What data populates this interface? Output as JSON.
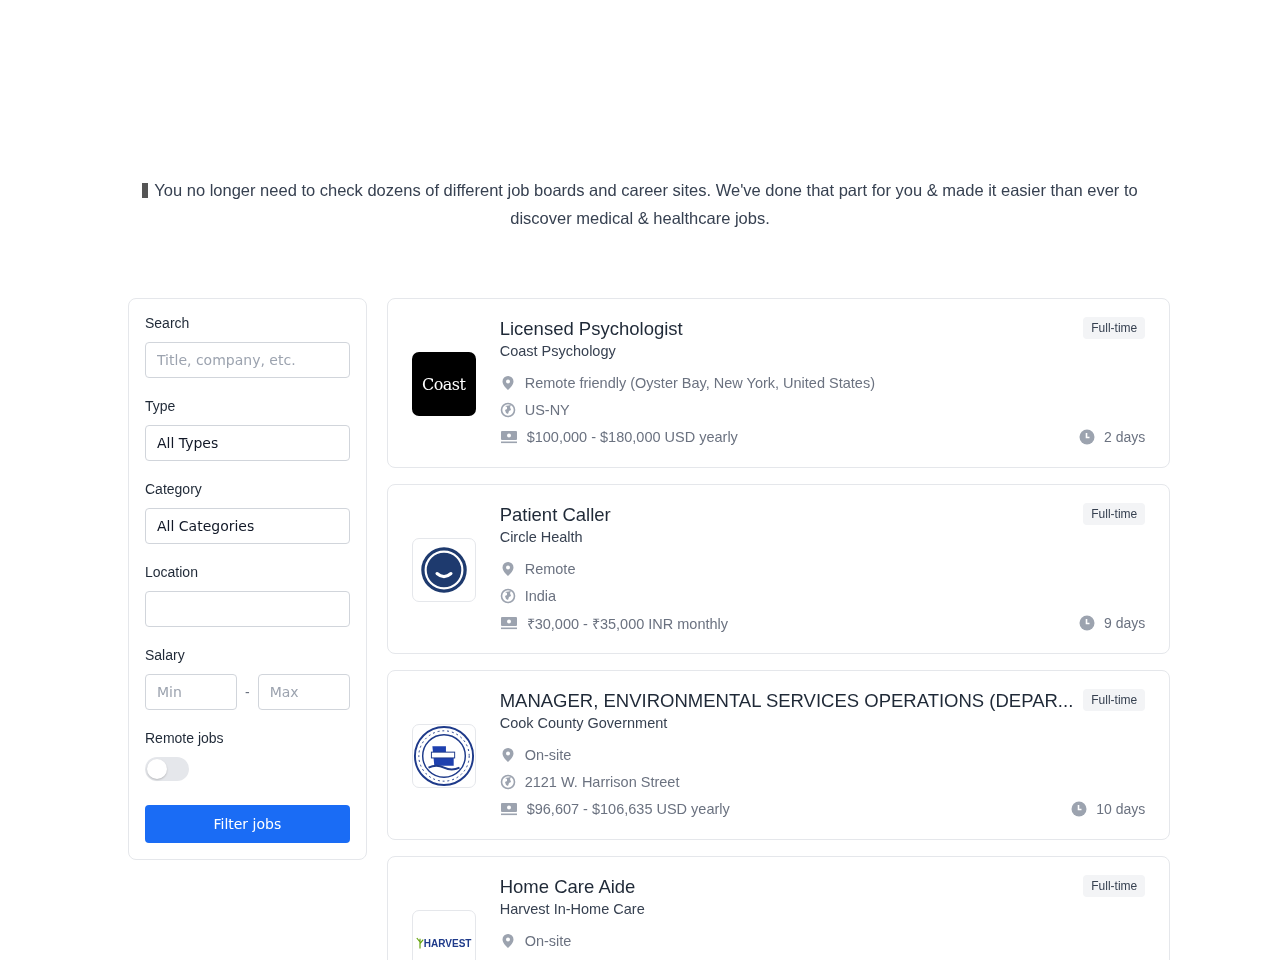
{
  "intro": "You no longer need to check dozens of different job boards and career sites. We've done that part for you & made it easier than ever to discover medical & healthcare jobs.",
  "filters": {
    "search": {
      "label": "Search",
      "placeholder": "Title, company, etc."
    },
    "type": {
      "label": "Type",
      "value": "All Types"
    },
    "category": {
      "label": "Category",
      "value": "All Categories"
    },
    "location": {
      "label": "Location"
    },
    "salary": {
      "label": "Salary",
      "min_placeholder": "Min",
      "separator": "-",
      "max_placeholder": "Max"
    },
    "remote": {
      "label": "Remote jobs",
      "on": false
    },
    "button": "Filter jobs"
  },
  "jobs": [
    {
      "title": "Licensed Psychologist",
      "company": "Coast Psychology",
      "logo": {
        "kind": "wordmark",
        "text": "Coast"
      },
      "type": "Full-time",
      "location": "Remote friendly (Oyster Bay, New York, United States)",
      "region": "US-NY",
      "salary": "$100,000 - $180,000 USD yearly",
      "age": "2 days"
    },
    {
      "title": "Patient Caller",
      "company": "Circle Health",
      "logo": {
        "kind": "smile"
      },
      "type": "Full-time",
      "location": "Remote",
      "region": "India",
      "salary": "₹30,000 - ₹35,000 INR monthly",
      "age": "9 days"
    },
    {
      "title": "MANAGER, ENVIRONMENTAL SERVICES OPERATIONS (DEPAR...",
      "company": "Cook County Government",
      "logo": {
        "kind": "seal"
      },
      "type": "Full-time",
      "location": "On-site",
      "region": "2121 W. Harrison Street",
      "salary": "$96,607 - $106,635 USD yearly",
      "age": "10 days"
    },
    {
      "title": "Home Care Aide",
      "company": "Harvest In-Home Care",
      "logo": {
        "kind": "leaf",
        "text": "HARVEST"
      },
      "type": "Full-time",
      "location": "On-site"
    }
  ]
}
